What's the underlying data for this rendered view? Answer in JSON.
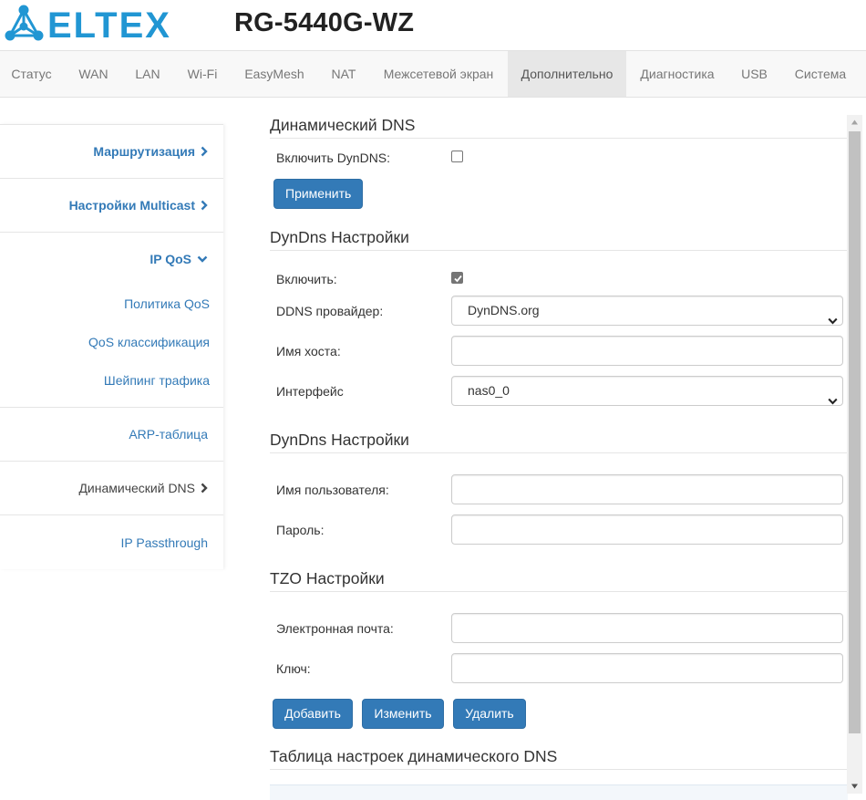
{
  "header": {
    "logo_text": "ELTEX",
    "model": "RG-5440G-WZ"
  },
  "nav": [
    {
      "label": "Статус"
    },
    {
      "label": "WAN"
    },
    {
      "label": "LAN"
    },
    {
      "label": "Wi-Fi"
    },
    {
      "label": "EasyMesh"
    },
    {
      "label": "NAT"
    },
    {
      "label": "Межсетевой экран"
    },
    {
      "label": "Дополнительно",
      "active": true
    },
    {
      "label": "Диагностика"
    },
    {
      "label": "USB"
    },
    {
      "label": "Система"
    }
  ],
  "sidebar": {
    "routing": "Маршрутизация",
    "multicast": "Настройки Multicast",
    "ipqos": "IP QoS",
    "qos_policy": "Политика QoS",
    "qos_class": "QoS классификация",
    "shaping": "Шейпинг трафика",
    "arp": "ARP-таблица",
    "ddns": "Динамический DNS",
    "passthrough": "IP Passthrough"
  },
  "dyndns_enable_section": {
    "title": "Динамический DNS",
    "enable_label": "Включить DynDNS:",
    "enable_checked": false,
    "apply_button": "Применить"
  },
  "dyndns_settings": {
    "title": "DynDns Настройки",
    "enable_label": "Включить:",
    "enable_checked": true,
    "provider_label": "DDNS провайдер:",
    "provider_value": "DynDNS.org",
    "hostname_label": "Имя хоста:",
    "hostname_value": "",
    "interface_label": "Интерфейс",
    "interface_value": "nas0_0"
  },
  "dyndns_account": {
    "title": "DynDns Настройки",
    "username_label": "Имя пользователя:",
    "username_value": "",
    "password_label": "Пароль:",
    "password_value": ""
  },
  "tzo_settings": {
    "title": "TZO Настройки",
    "email_label": "Электронная почта:",
    "email_value": "",
    "key_label": "Ключ:",
    "key_value": ""
  },
  "actions": {
    "add": "Добавить",
    "edit": "Изменить",
    "delete": "Удалить"
  },
  "table_section": {
    "title": "Таблица настроек динамического DNS"
  },
  "colors": {
    "brand_blue": "#337ab7",
    "logo_blue": "#2196d3",
    "nav_active_bg": "#e7e7e7"
  }
}
